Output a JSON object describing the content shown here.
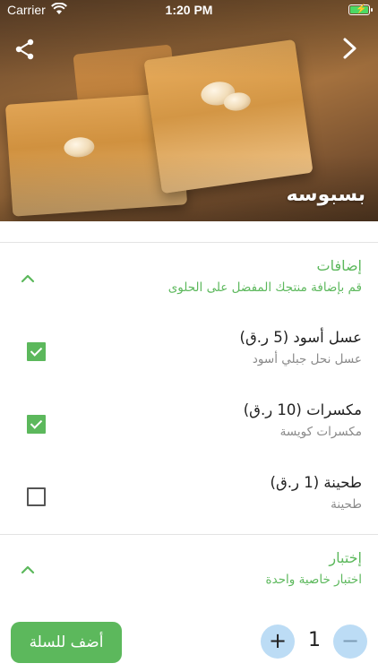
{
  "status_bar": {
    "carrier": "Carrier",
    "time": "1:20 PM"
  },
  "product": {
    "title": "بسبوسه"
  },
  "sections": {
    "additions": {
      "title": "إضافات",
      "subtitle": "قم بإضافة منتجك المفضل على الحلوى",
      "options": [
        {
          "name": "عسل أسود (5 ر.ق)",
          "description": "عسل نحل جبلي أسود",
          "checked": true
        },
        {
          "name": "مكسرات (10 ر.ق)",
          "description": "مكسرات كويسة",
          "checked": true
        },
        {
          "name": "طحينة (1 ر.ق)",
          "description": "طحينة",
          "checked": false
        }
      ]
    },
    "choice": {
      "title": "إختبار",
      "subtitle": "اختبار خاصية واحدة"
    }
  },
  "cart": {
    "add_label": "أضف للسلة",
    "quantity": "1",
    "plus": "+",
    "minus": "−"
  },
  "colors": {
    "accent": "#5cb85c",
    "stepper": "#bcdcf5",
    "status_battery": "#4cd964"
  },
  "icons": [
    "wifi-icon",
    "battery-icon",
    "share-icon",
    "chevron-right-icon",
    "chevron-up-icon",
    "checkbox-checked-icon",
    "checkbox-empty-icon"
  ]
}
